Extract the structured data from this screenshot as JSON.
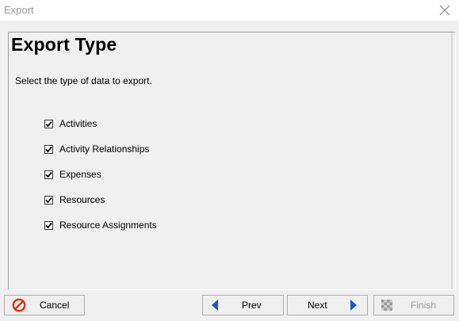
{
  "window": {
    "title": "Export"
  },
  "page": {
    "heading": "Export Type",
    "subtitle": "Select the type of data to export."
  },
  "options": [
    {
      "label": "Activities",
      "checked": true
    },
    {
      "label": "Activity Relationships",
      "checked": true
    },
    {
      "label": "Expenses",
      "checked": true
    },
    {
      "label": "Resources",
      "checked": true
    },
    {
      "label": "Resource Assignments",
      "checked": true
    }
  ],
  "buttons": {
    "cancel": "Cancel",
    "prev": "Prev",
    "next": "Next",
    "finish": "Finish"
  },
  "colors": {
    "cancel_icon": "#e0301e",
    "nav_arrow": "#1a57c8"
  }
}
